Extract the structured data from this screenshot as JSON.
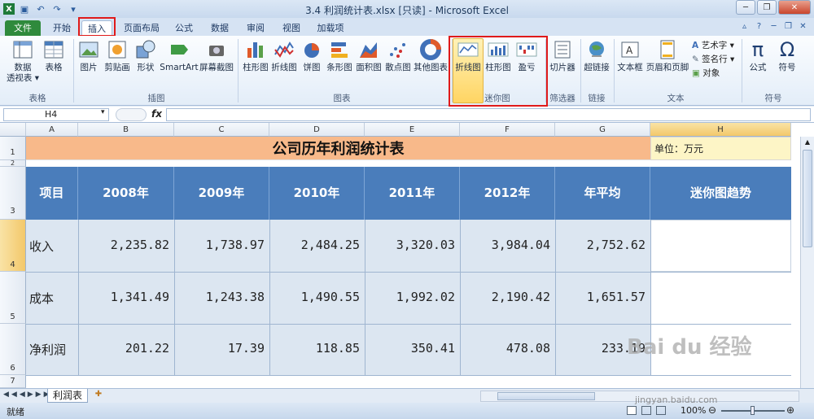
{
  "window": {
    "title": "3.4 利润统计表.xlsx  [只读]  -  Microsoft Excel"
  },
  "tabs": [
    "文件",
    "开始",
    "插入",
    "页面布局",
    "公式",
    "数据",
    "审阅",
    "视图",
    "加载项"
  ],
  "ribbon": {
    "buttons": [
      "数据\n透视表 ▾",
      "表格",
      "图片",
      "剪贴画",
      "形状",
      "SmartArt",
      "屏幕截图",
      "柱形图",
      "折线图",
      "饼图",
      "条形图",
      "面积图",
      "散点图",
      "其他图表",
      "折线图",
      "柱形图",
      "盈亏",
      "切片器",
      "超链接",
      "文本框",
      "页眉和页脚",
      "公式",
      "符号"
    ],
    "small_items": [
      "艺术字 ▾",
      "签名行 ▾",
      "对象"
    ],
    "groups": [
      "表格",
      "插图",
      "图表",
      "迷你图",
      "筛选器",
      "链接",
      "文本",
      "符号"
    ]
  },
  "formula_bar": {
    "name_box": "H4",
    "fx": "fx",
    "value": ""
  },
  "columns": [
    "A",
    "B",
    "C",
    "D",
    "E",
    "F",
    "G",
    "H"
  ],
  "rows": [
    "1",
    "2",
    "3",
    "4",
    "5",
    "6",
    "7"
  ],
  "sheet": {
    "title": "公司历年利润统计表",
    "unit": "单位：万元",
    "headers": [
      "项目",
      "2008年",
      "2009年",
      "2010年",
      "2011年",
      "2012年",
      "年平均",
      "迷你图趋势"
    ],
    "data_rows": [
      {
        "label": "收入",
        "values": [
          "2,235.82",
          "1,738.97",
          "2,484.25",
          "3,320.03",
          "3,984.04",
          "2,752.62"
        ]
      },
      {
        "label": "成本",
        "values": [
          "1,341.49",
          "1,243.38",
          "1,490.55",
          "1,992.02",
          "2,190.42",
          "1,651.57"
        ]
      },
      {
        "label": "净利润",
        "values": [
          "201.22",
          "17.39",
          "118.85",
          "350.41",
          "478.08",
          "233.19"
        ]
      }
    ]
  },
  "sheet_tabs": {
    "active": "利润表"
  },
  "status": {
    "ready": "就绪",
    "zoom": "100%"
  },
  "watermark": {
    "brand": "Bai du 经验",
    "url": "jingyan.baidu.com"
  },
  "colors": {
    "title_fill": "#f8b98a",
    "header_fill": "#4a7dbb",
    "row_fill": "#dce6f1",
    "unit_fill": "#fdf5c6",
    "file_tab": "#2f8a3c",
    "highlight": "#e01a1a"
  }
}
